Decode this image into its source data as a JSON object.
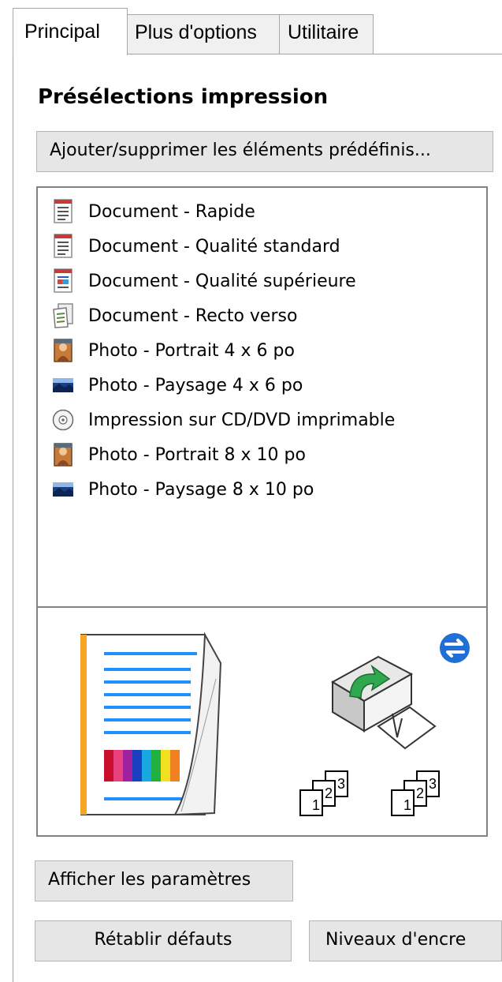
{
  "tabs": [
    {
      "label": "Principal",
      "active": true
    },
    {
      "label": "Plus d'options",
      "active": false
    },
    {
      "label": "Utilitaire",
      "active": false
    }
  ],
  "presets": {
    "title": "Présélections impression",
    "add_remove_button": "Ajouter/supprimer les éléments prédéfinis...",
    "items": [
      {
        "label": "Document - Rapide",
        "icon": "document-icon"
      },
      {
        "label": "Document - Qualité standard",
        "icon": "document-icon"
      },
      {
        "label": "Document - Qualité supérieure",
        "icon": "document-color-icon"
      },
      {
        "label": "Document - Recto verso",
        "icon": "document-duplex-icon"
      },
      {
        "label": "Photo - Portrait 4 x 6 po",
        "icon": "photo-portrait-icon"
      },
      {
        "label": "Photo - Paysage 4 x 6 po",
        "icon": "photo-landscape-icon"
      },
      {
        "label": "Impression sur CD/DVD imprimable",
        "icon": "cd-icon"
      },
      {
        "label": "Photo - Portrait 8 x 10 po",
        "icon": "photo-portrait-icon"
      },
      {
        "label": "Photo - Paysage 8 x 10 po",
        "icon": "photo-landscape-icon"
      }
    ]
  },
  "preview": {
    "collate_digits": [
      "1",
      "2",
      "3"
    ]
  },
  "buttons": {
    "show_settings": "Afficher les paramètres",
    "restore_defaults": "Rétablir défauts",
    "ink_levels": "Niveaux d'encre"
  },
  "colors": {
    "accent_orange": "#f5a623",
    "line_blue": "#1e90ff",
    "sync_blue": "#1f6fd6",
    "arrow_green": "#2fa84f"
  }
}
